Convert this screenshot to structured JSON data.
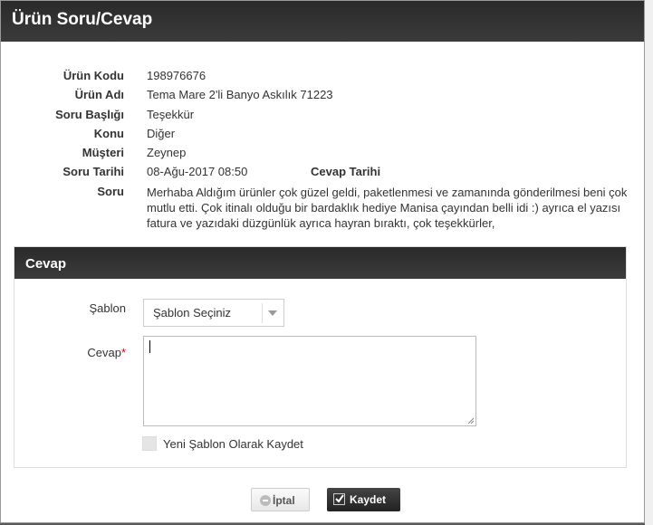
{
  "modal": {
    "title": "Ürün Soru/Cevap"
  },
  "info": [
    {
      "label": "Ürün Kodu",
      "value": "198976676"
    },
    {
      "label": "Ürün Adı",
      "value": "Tema Mare 2'li Banyo Askılık 71223"
    },
    {
      "label": "Soru Başlığı",
      "value": "Teşekkür"
    },
    {
      "label": "Konu",
      "value": "Diğer"
    },
    {
      "label": "Müşteri",
      "value": "Zeynep"
    },
    {
      "label": "Soru Tarihi",
      "value": "08-Ağu-2017 08:50"
    }
  ],
  "answer_date_label": "Cevap Tarihi",
  "question": {
    "label": "Soru",
    "text": "Merhaba Aldığım ürünler çok güzel geldi, paketlenmesi ve zamanında gönderilmesi beni çok mutlu etti. Çok itinalı olduğu bir bardaklık hediye Manisa çayından belli idi :) ayrıca el yazısı fatura ve yazıdaki düzgünlük ayrıca hayran bıraktı, çok teşekkürler,"
  },
  "answer_panel": {
    "title": "Cevap",
    "template_label": "Şablon",
    "template_selected": "Şablon Seçiniz",
    "answer_label": "Cevap",
    "required_mark": "*",
    "answer_value": "",
    "save_template_label": "Yeni Şablon Olarak Kaydet"
  },
  "buttons": {
    "cancel": "İptal",
    "save": "Kaydet"
  },
  "colors": {
    "header_bg": "#2e2e2e",
    "required": "#dd0000",
    "save_button": "#222222"
  }
}
